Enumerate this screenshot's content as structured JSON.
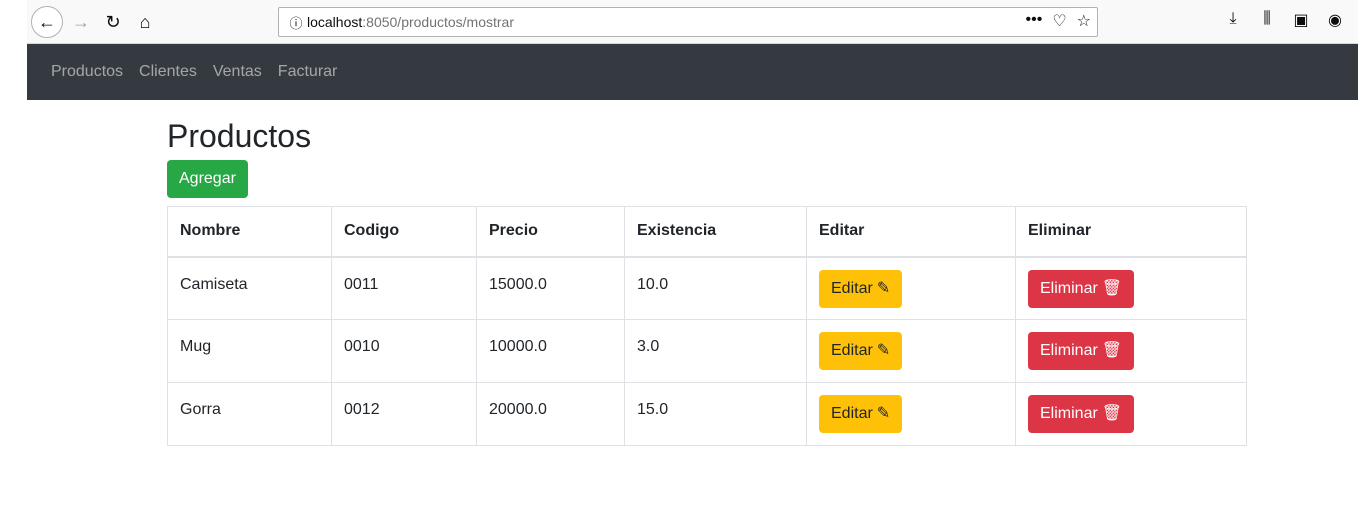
{
  "browser": {
    "url_host": "localhost",
    "url_rest": ":8050/productos/mostrar",
    "icons": [
      "back-icon",
      "forward-icon",
      "reload-icon",
      "home-icon",
      "info-icon",
      "more-icon",
      "pocket-icon",
      "star-icon",
      "download-icon",
      "library-icon",
      "sidebar-icon",
      "account-icon"
    ]
  },
  "navbar": {
    "items": [
      {
        "label": "Productos"
      },
      {
        "label": "Clientes"
      },
      {
        "label": "Ventas"
      },
      {
        "label": "Facturar"
      }
    ]
  },
  "page": {
    "title": "Productos",
    "add_label": "Agregar"
  },
  "table": {
    "headers": [
      "Nombre",
      "Codigo",
      "Precio",
      "Existencia",
      "Editar",
      "Eliminar"
    ],
    "rows": [
      {
        "nombre": "Camiseta",
        "codigo": "0011",
        "precio": "15000.0",
        "existencia": "10.0"
      },
      {
        "nombre": "Mug",
        "codigo": "0010",
        "precio": "10000.0",
        "existencia": "3.0"
      },
      {
        "nombre": "Gorra",
        "codigo": "0012",
        "precio": "20000.0",
        "existencia": "15.0"
      }
    ],
    "edit_label": "Editar",
    "delete_label": "Eliminar"
  },
  "colors": {
    "navbar_bg": "#343a40",
    "add_button": "#28a745",
    "edit_button": "#ffc107",
    "delete_button": "#dc3545"
  }
}
